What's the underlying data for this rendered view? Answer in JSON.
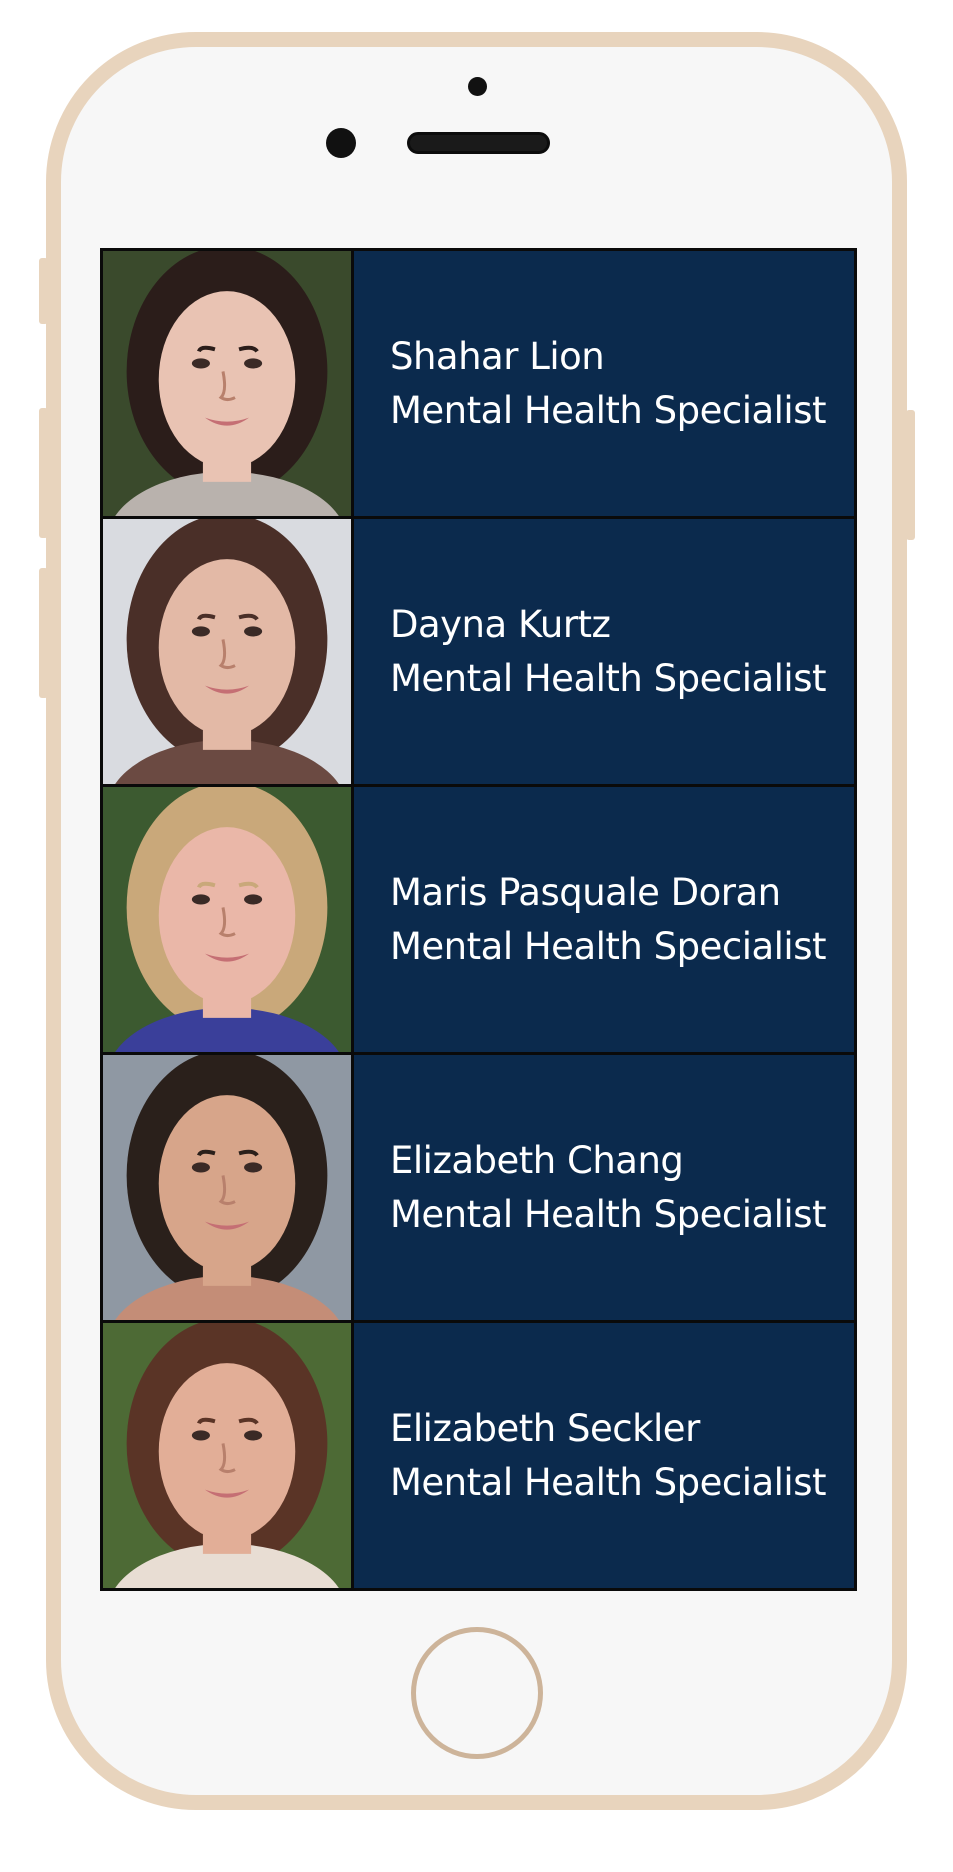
{
  "specialists": [
    {
      "name": "Shahar Lion",
      "title": "Mental Health Specialist",
      "hair": "#2b1d1a",
      "skin": "#e9c3b3",
      "bg": "#3a4a2c",
      "shirt": "#b9b2ad"
    },
    {
      "name": "Dayna Kurtz",
      "title": "Mental Health Specialist",
      "hair": "#4a2f28",
      "skin": "#e3b9a6",
      "bg": "#d9dbe0",
      "shirt": "#6b4a42"
    },
    {
      "name": "Maris Pasquale Doran",
      "title": "Mental Health Specialist",
      "hair": "#c9a87a",
      "skin": "#eab7a8",
      "bg": "#3c5a30",
      "shirt": "#3a3f9a"
    },
    {
      "name": "Elizabeth Chang",
      "title": "Mental Health Specialist",
      "hair": "#2a201b",
      "skin": "#d7a58a",
      "bg": "#8f98a3",
      "shirt": "#c48d77"
    },
    {
      "name": "Elizabeth Seckler",
      "title": "Mental Health Specialist",
      "hair": "#5a3426",
      "skin": "#e2ae97",
      "bg": "#4d6a35",
      "shirt": "#e8ddd3"
    }
  ],
  "colors": {
    "panel": "#0b2a4d",
    "frame": "#e8d4bd",
    "text": "#ffffff"
  }
}
